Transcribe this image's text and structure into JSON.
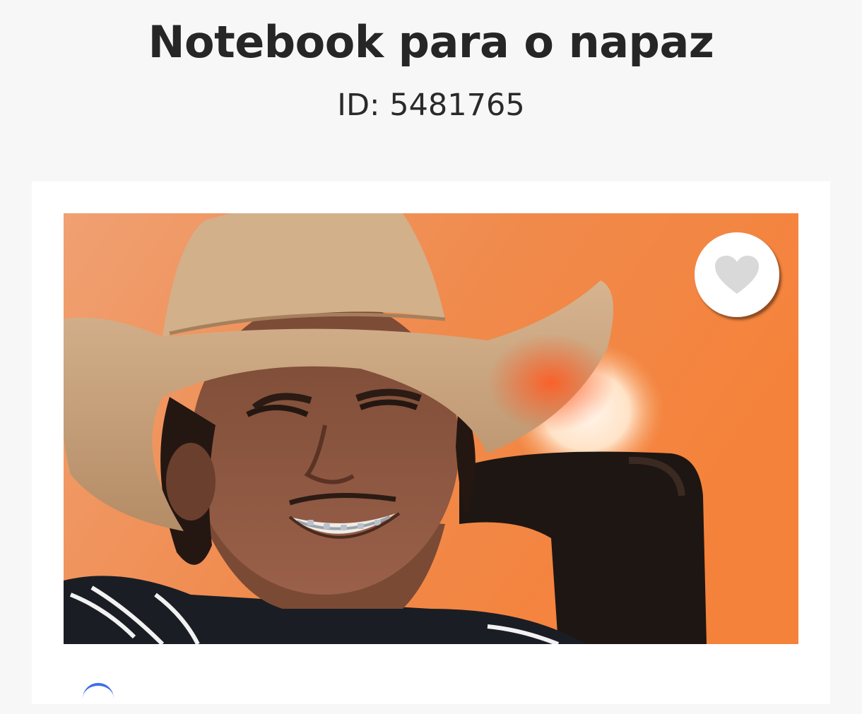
{
  "header": {
    "title": "Notebook para o napaz",
    "id_text": "ID: 5481765"
  },
  "campaign": {
    "image_alt": "Foto de jovem sorrindo com chapéu de cowboy",
    "favorite_icon": "heart-icon"
  },
  "colors": {
    "background": "#f7f7f7",
    "card": "#ffffff",
    "title_text": "#262626",
    "heart": "#d6d6d6",
    "accent": "#3d6ee8"
  }
}
